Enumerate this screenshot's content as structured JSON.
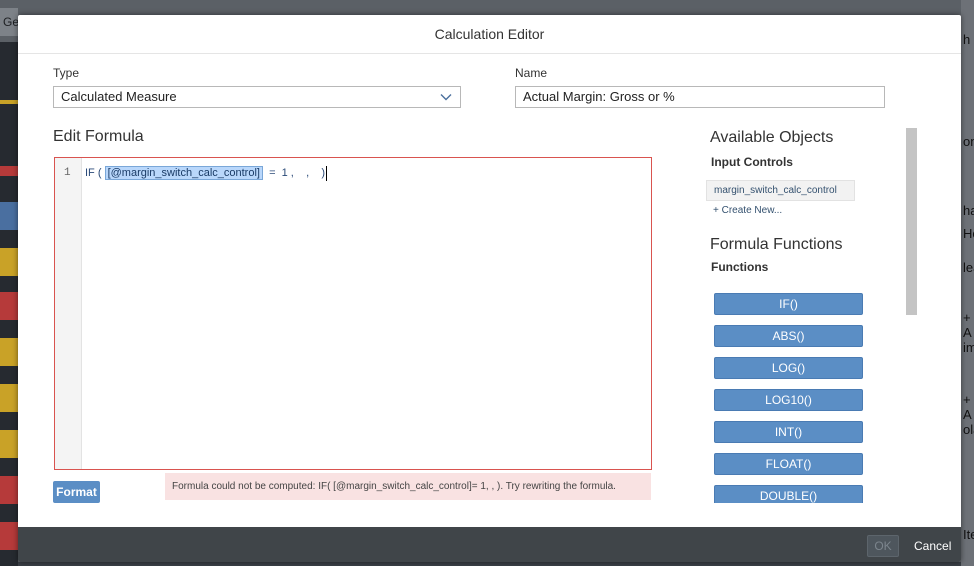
{
  "background": {
    "tab_label": "Ge",
    "right_glyphs": [
      "h",
      "on",
      "ha",
      "Ho",
      "lea",
      "+ A",
      "im",
      "+ A",
      "ola",
      "Ite"
    ]
  },
  "dialog": {
    "title": "Calculation Editor",
    "type_label": "Type",
    "type_value": "Calculated Measure",
    "name_label": "Name",
    "name_value": "Actual Margin: Gross or %",
    "edit_formula_label": "Edit Formula",
    "line_number": "1",
    "formula": {
      "prefix": "IF ( ",
      "token": "[@margin_switch_calc_control]",
      "suffix": "  =  1 ,    ,    )"
    },
    "format_label": "Format",
    "error_message": "Formula could not be computed: IF( [@margin_switch_calc_control]= 1, , ). Try rewriting the formula."
  },
  "panel": {
    "available_objects": "Available Objects",
    "input_controls": "Input Controls",
    "input_control_item": "margin_switch_calc_control",
    "create_new": "+ Create New...",
    "formula_functions": "Formula Functions",
    "functions": "Functions",
    "function_items": [
      "IF()",
      "ABS()",
      "LOG()",
      "LOG10()",
      "INT()",
      "FLOAT()",
      "DOUBLE()"
    ]
  },
  "footer": {
    "ok_label": "OK",
    "cancel_label": "Cancel"
  },
  "colors": {
    "accent": "#5b8ec5",
    "error_border": "#d9534f",
    "error_bg": "#f9e2e2",
    "footer_bg": "#404549"
  }
}
